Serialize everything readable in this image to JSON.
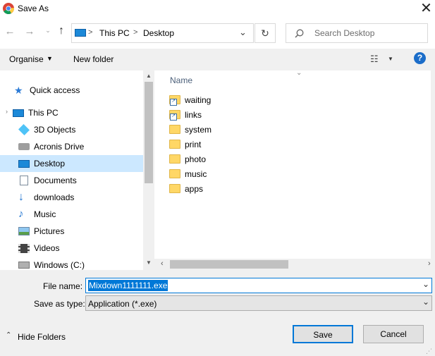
{
  "window": {
    "title": "Save As"
  },
  "address": {
    "crumbs": [
      "This PC",
      "Desktop"
    ],
    "separator": ">"
  },
  "search": {
    "placeholder": "Search Desktop"
  },
  "toolbar": {
    "organise": "Organise",
    "new_folder": "New folder"
  },
  "nav": {
    "quick_access": "Quick access",
    "this_pc": "This PC",
    "items": [
      "3D Objects",
      "Acronis Drive",
      "Desktop",
      "Documents",
      "downloads",
      "Music",
      "Pictures",
      "Videos",
      "Windows (C:)"
    ]
  },
  "files": {
    "column": "Name",
    "items": [
      "waiting",
      "links",
      "system",
      "print",
      "photo",
      "music",
      "apps"
    ]
  },
  "form": {
    "file_name_label": "File name:",
    "file_name_value": "Mixdown1111111.exe",
    "type_label": "Save as type:",
    "type_value": "Application (*.exe)"
  },
  "footer": {
    "hide_folders": "Hide Folders",
    "save": "Save",
    "cancel": "Cancel"
  },
  "colors": {
    "accent": "#0078d7",
    "selected": "#cce8ff",
    "folder": "#ffd766"
  }
}
